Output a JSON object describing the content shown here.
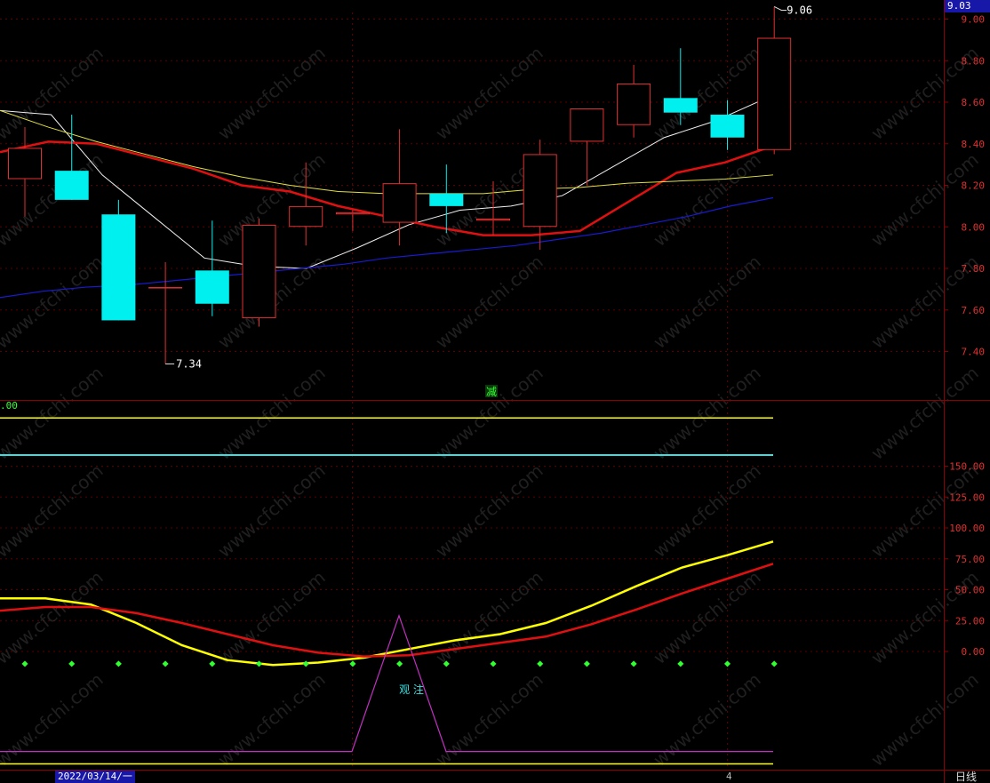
{
  "header": {
    "current_price_badge": "9.03"
  },
  "footer": {
    "date_label": "2022/03/14/一",
    "period_label": "日线",
    "axis_tick": "4"
  },
  "watermark": "www.cfchi.com",
  "colors": {
    "background": "#000000",
    "frame": "#8b0000",
    "up_candle": "#e03030",
    "down_candle": "#00f0f0",
    "ma_fast": "#f0f0f0",
    "ma_mid": "#e01010",
    "ma_slow": "#e0e040",
    "ma_long": "#1a1ad0",
    "osc_yellow": "#ffff00",
    "osc_red": "#e01010",
    "osc_cyan": "#3ae0e0",
    "osc_purple": "#c030c0",
    "osc_dots": "#30ff30"
  },
  "chart_data": [
    {
      "type": "candlestick",
      "ylim": [
        7.2,
        9.1
      ],
      "y_ticks": [
        "9.00",
        "8.80",
        "8.60",
        "8.40",
        "8.20",
        "8.00",
        "7.80",
        "7.60",
        "7.40"
      ],
      "candles": [
        {
          "open": 8.23,
          "high": 8.48,
          "low": 8.05,
          "close": 8.38
        },
        {
          "open": 8.27,
          "high": 8.54,
          "low": 8.13,
          "close": 8.13
        },
        {
          "open": 8.06,
          "high": 8.13,
          "low": 7.55,
          "close": 7.55
        },
        {
          "open": 7.71,
          "high": 7.83,
          "low": 7.34,
          "close": 7.71
        },
        {
          "open": 7.79,
          "high": 8.03,
          "low": 7.57,
          "close": 7.63
        },
        {
          "open": 7.56,
          "high": 8.04,
          "low": 7.52,
          "close": 8.01
        },
        {
          "open": 8.0,
          "high": 8.31,
          "low": 7.91,
          "close": 8.1
        },
        {
          "open": 8.06,
          "high": 8.08,
          "low": 7.98,
          "close": 8.07
        },
        {
          "open": 8.02,
          "high": 8.47,
          "low": 7.91,
          "close": 8.21
        },
        {
          "open": 8.16,
          "high": 8.3,
          "low": 7.97,
          "close": 8.1
        },
        {
          "open": 8.03,
          "high": 8.22,
          "low": 7.96,
          "close": 8.04
        },
        {
          "open": 8.0,
          "high": 8.42,
          "low": 7.89,
          "close": 8.35
        },
        {
          "open": 8.41,
          "high": 8.57,
          "low": 8.2,
          "close": 8.57
        },
        {
          "open": 8.49,
          "high": 8.78,
          "low": 8.43,
          "close": 8.69
        },
        {
          "open": 8.62,
          "high": 8.86,
          "low": 8.49,
          "close": 8.55
        },
        {
          "open": 8.54,
          "high": 8.61,
          "low": 8.37,
          "close": 8.43
        },
        {
          "open": 8.37,
          "high": 9.06,
          "low": 8.35,
          "close": 8.91
        }
      ],
      "moving_averages": [
        {
          "key": "ma_fast",
          "values": [
            8.56,
            8.54,
            8.25,
            8.05,
            7.85,
            7.81,
            7.8,
            7.9,
            8.01,
            8.08,
            8.1,
            8.15,
            8.29,
            8.43,
            8.51,
            8.62
          ]
        },
        {
          "key": "ma_mid",
          "values": [
            8.36,
            8.41,
            8.4,
            8.34,
            8.28,
            8.2,
            8.17,
            8.1,
            8.05,
            8.0,
            7.96,
            7.96,
            7.98,
            8.12,
            8.26,
            8.31,
            8.39
          ]
        },
        {
          "key": "ma_slow",
          "values": [
            8.56,
            8.48,
            8.41,
            8.35,
            8.29,
            8.24,
            8.2,
            8.17,
            8.16,
            8.16,
            8.16,
            8.18,
            8.19,
            8.21,
            8.22,
            8.23,
            8.25
          ]
        },
        {
          "key": "ma_long",
          "values": [
            7.66,
            7.69,
            7.71,
            7.72,
            7.74,
            7.76,
            7.78,
            7.8,
            7.82,
            7.85,
            7.87,
            7.89,
            7.91,
            7.94,
            7.97,
            8.01,
            8.05,
            8.1,
            8.14
          ]
        }
      ],
      "annotations": {
        "high_label": "9.06",
        "low_label": "7.34",
        "signal_label": "减"
      }
    },
    {
      "type": "line",
      "y_ticks": [
        "150.00",
        "125.00",
        "100.00",
        "75.00",
        "50.00",
        "25.00",
        "0.00"
      ],
      "value_label": ".00",
      "series": [
        {
          "key": "osc_yellow",
          "values": [
            43,
            43,
            38,
            23,
            5,
            -7,
            -11,
            -9,
            -5,
            2,
            9,
            14,
            23,
            37,
            53,
            68,
            78,
            89
          ]
        },
        {
          "key": "osc_red",
          "values": [
            33,
            36,
            36,
            31,
            23,
            14,
            5,
            -1,
            -4,
            -3,
            2,
            7,
            12,
            22,
            34,
            47,
            59,
            71
          ]
        }
      ],
      "reference_lines": [
        {
          "key": "osc_yellow",
          "value": 189
        },
        {
          "key": "osc_cyan",
          "value": 159
        },
        {
          "key": "osc_yellow",
          "value": -91
        }
      ],
      "signal_line": {
        "key": "osc_purple",
        "base": -81,
        "peak": 29
      },
      "dot_row_value": -10,
      "annotation": "观 注"
    }
  ]
}
